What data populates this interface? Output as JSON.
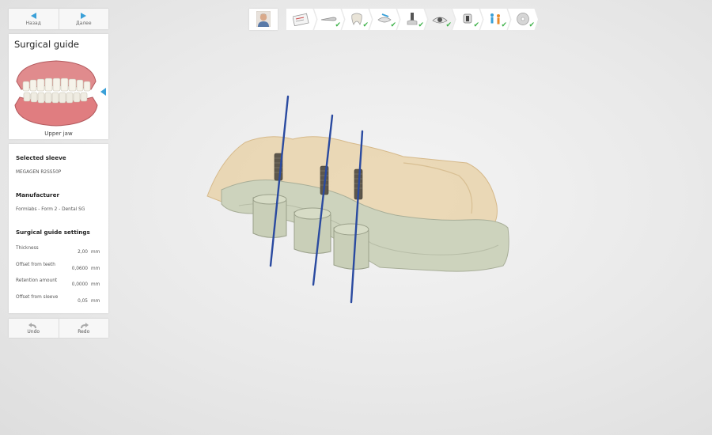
{
  "nav": {
    "back_label": "Назад",
    "forward_label": "Далее"
  },
  "guide": {
    "title": "Surgical guide",
    "jaw_label": "Upper jaw"
  },
  "settings": {
    "selected_sleeve_label": "Selected sleeve",
    "selected_sleeve_value": "MEGAGEN R2SS50P",
    "manufacturer_label": "Manufacturer",
    "manufacturer_value": "Formlabs - Form 2 - Dental SG",
    "section_label": "Surgical guide settings",
    "fields": [
      {
        "label": "Thickness",
        "value": "2,00",
        "unit": "mm"
      },
      {
        "label": "Offset from teeth",
        "value": "0,0600",
        "unit": "mm"
      },
      {
        "label": "Retention amount",
        "value": "0,0000",
        "unit": "mm"
      },
      {
        "label": "Offset from sleeve",
        "value": "0,05",
        "unit": "mm"
      }
    ]
  },
  "history": {
    "undo_label": "Undo",
    "redo_label": "Redo"
  },
  "workflow": {
    "steps": [
      {
        "icon": "patient-card-icon",
        "done": false
      },
      {
        "icon": "scanner-icon",
        "done": true
      },
      {
        "icon": "tooth-icon",
        "done": true
      },
      {
        "icon": "model-edit-icon",
        "done": true
      },
      {
        "icon": "implant-icon",
        "done": true
      },
      {
        "icon": "guide-eye-icon",
        "done": true
      },
      {
        "icon": "sleeve-icon",
        "done": true
      },
      {
        "icon": "export-people-icon",
        "done": true
      },
      {
        "icon": "disc-icon",
        "done": true
      }
    ],
    "check_glyph": "✔"
  },
  "colors": {
    "accent": "#3aa0d8",
    "check": "#3fb24a",
    "implant_axis": "#2a4aa0",
    "guide_body": "#cdd3bd",
    "model_cast": "#e8cfa0"
  }
}
